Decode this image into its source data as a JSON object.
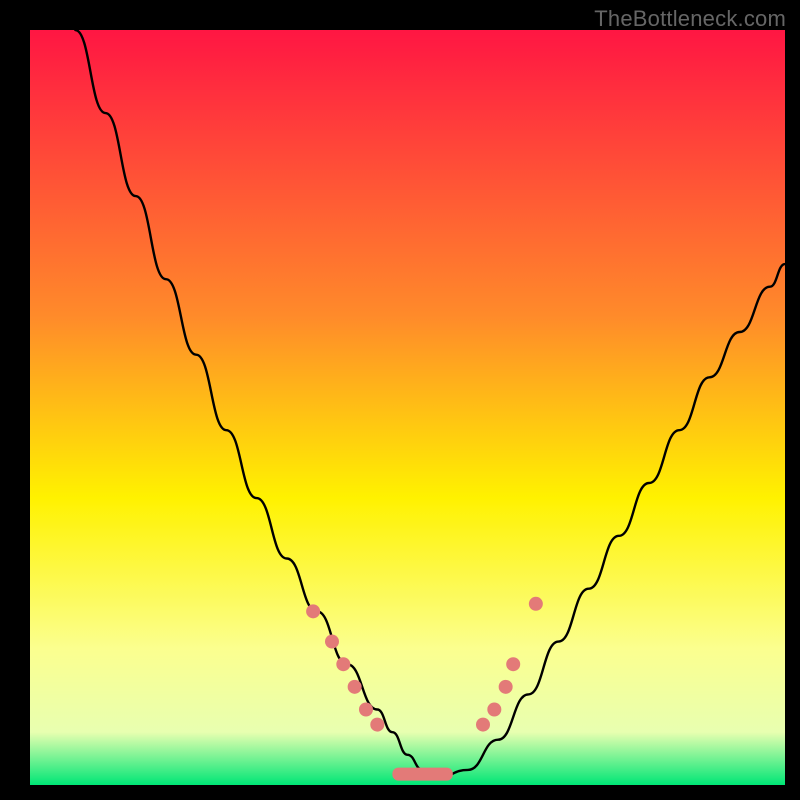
{
  "watermark": "TheBottleneck.com",
  "colors": {
    "frame": "#000000",
    "gradient_top": "#ff1643",
    "gradient_mid_top": "#ff8b2a",
    "gradient_mid": "#fff200",
    "gradient_low": "#fbff8f",
    "gradient_bottom": "#00e676",
    "curve": "#000000",
    "marker_fill": "#e37a78",
    "marker_stroke": "#e37a78"
  },
  "chart_data": {
    "type": "line",
    "title": "",
    "xlabel": "",
    "ylabel": "",
    "xlim": [
      0,
      100
    ],
    "ylim": [
      0,
      100
    ],
    "grid": false,
    "series": [
      {
        "name": "bottleneck-curve",
        "x": [
          6,
          10,
          14,
          18,
          22,
          26,
          30,
          34,
          38,
          42,
          46,
          48,
          50,
          52,
          54,
          58,
          62,
          66,
          70,
          74,
          78,
          82,
          86,
          90,
          94,
          98,
          100
        ],
        "y": [
          100,
          89,
          78,
          67,
          57,
          47,
          38,
          30,
          23,
          16,
          10,
          7,
          4,
          2,
          1,
          2,
          6,
          12,
          19,
          26,
          33,
          40,
          47,
          54,
          60,
          66,
          69
        ]
      }
    ],
    "markers": [
      {
        "name": "left-dot-1",
        "x": 37.5,
        "y": 23
      },
      {
        "name": "left-dot-2",
        "x": 40.0,
        "y": 19
      },
      {
        "name": "left-dot-3",
        "x": 41.5,
        "y": 16
      },
      {
        "name": "left-dot-4",
        "x": 43.0,
        "y": 13
      },
      {
        "name": "left-dot-5",
        "x": 44.5,
        "y": 10
      },
      {
        "name": "left-dot-6",
        "x": 46.0,
        "y": 8
      },
      {
        "name": "right-dot-1",
        "x": 60.0,
        "y": 8
      },
      {
        "name": "right-dot-2",
        "x": 61.5,
        "y": 10
      },
      {
        "name": "right-dot-3",
        "x": 63.0,
        "y": 13
      },
      {
        "name": "right-dot-4",
        "x": 64.0,
        "y": 16
      },
      {
        "name": "right-dot-5",
        "x": 67.0,
        "y": 24
      }
    ],
    "flat_segment": {
      "name": "bottom-flat",
      "x_start": 48,
      "x_end": 56,
      "y": 1.5
    }
  }
}
